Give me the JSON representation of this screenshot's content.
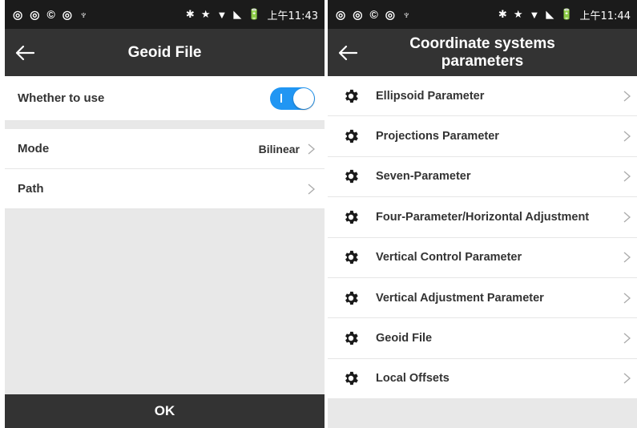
{
  "left": {
    "status": {
      "icons_left": [
        "◎",
        "◎",
        "©",
        "◎",
        "♆"
      ],
      "icons_right": [
        "✱",
        "★",
        "▼",
        "◣",
        "🔋"
      ],
      "time": "上午11:43"
    },
    "title": "Geoid File",
    "whether_to_use_label": "Whether to use",
    "toggle_on": true,
    "mode_label": "Mode",
    "mode_value": "Bilinear",
    "path_label": "Path",
    "ok_label": "OK"
  },
  "right": {
    "status": {
      "icons_left": [
        "◎",
        "◎",
        "©",
        "◎",
        "♆"
      ],
      "icons_right": [
        "✱",
        "★",
        "▼",
        "◣",
        "🔋"
      ],
      "time": "上午11:44"
    },
    "title": "Coordinate systems parameters",
    "items": [
      {
        "label": "Ellipsoid Parameter"
      },
      {
        "label": "Projections Parameter"
      },
      {
        "label": "Seven-Parameter"
      },
      {
        "label": "Four-Parameter/Horizontal Adjustment"
      },
      {
        "label": "Vertical Control Parameter"
      },
      {
        "label": "Vertical Adjustment Parameter"
      },
      {
        "label": "Geoid File"
      },
      {
        "label": "Local Offsets"
      }
    ]
  },
  "colors": {
    "topbar": "#333333",
    "accent": "#2196f3",
    "background": "#e8e8e8"
  }
}
